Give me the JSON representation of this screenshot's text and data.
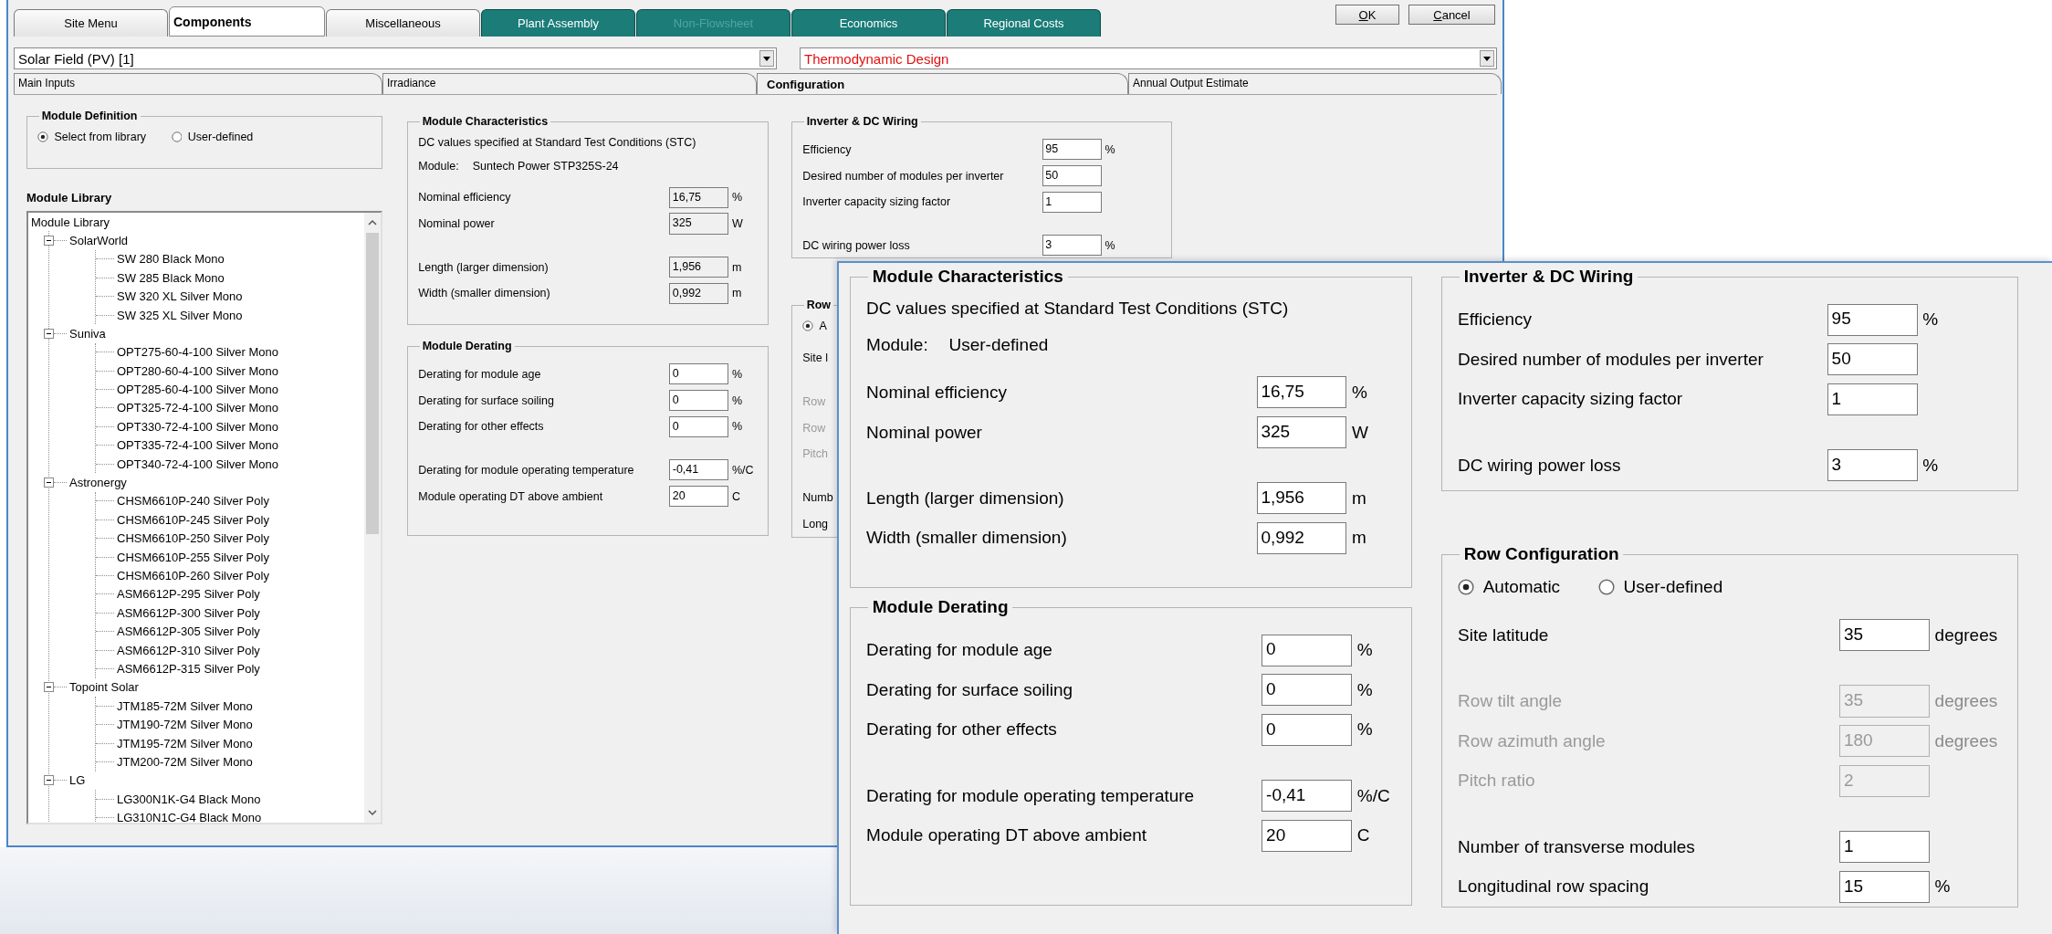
{
  "top_tabs": [
    {
      "label": "Site Menu",
      "selected": false,
      "kind": "menu",
      "disabled": false
    },
    {
      "label": "Components",
      "selected": true,
      "kind": "menu",
      "disabled": false
    },
    {
      "label": "Miscellaneous",
      "selected": false,
      "kind": "menu",
      "disabled": false
    },
    {
      "label": "Plant Assembly",
      "selected": false,
      "kind": "flowsheet",
      "disabled": false
    },
    {
      "label": "Non-Flowsheet",
      "selected": false,
      "kind": "flowsheet",
      "disabled": true
    },
    {
      "label": "Economics",
      "selected": false,
      "kind": "flowsheet",
      "disabled": false
    },
    {
      "label": "Regional Costs",
      "selected": false,
      "kind": "flowsheet",
      "disabled": false
    }
  ],
  "dialog_buttons": [
    {
      "mnemonic": "O",
      "rest": "K"
    },
    {
      "mnemonic": "C",
      "rest": "ancel"
    }
  ],
  "component_select": {
    "value": "Solar Field (PV) [1]"
  },
  "design_mode_select": {
    "value": "Thermodynamic Design"
  },
  "sub_tabs": [
    {
      "label": "Main Inputs",
      "selected": false
    },
    {
      "label": "Irradiance",
      "selected": false
    },
    {
      "label": "Configuration",
      "selected": true
    },
    {
      "label": "Annual Output Estimate",
      "selected": false
    }
  ],
  "configuration": {
    "module_definition": {
      "title": "Module Definition",
      "options": [
        {
          "label": "Select from library",
          "selected": true
        },
        {
          "label": "User-defined",
          "selected": false
        }
      ]
    },
    "module_library": {
      "title": "Module Library",
      "tree": {
        "label": "Module Library",
        "children": [
          {
            "label": "SolarWorld",
            "expanded": true,
            "children": [
              {
                "label": "SW 280 Black Mono"
              },
              {
                "label": "SW 285 Black Mono"
              },
              {
                "label": "SW 320 XL Silver Mono"
              },
              {
                "label": "SW 325 XL Silver Mono"
              }
            ]
          },
          {
            "label": "Suniva",
            "expanded": true,
            "children": [
              {
                "label": "OPT275-60-4-100 Silver Mono"
              },
              {
                "label": "OPT280-60-4-100 Silver Mono"
              },
              {
                "label": "OPT285-60-4-100 Silver Mono"
              },
              {
                "label": "OPT325-72-4-100 Silver Mono"
              },
              {
                "label": "OPT330-72-4-100 Silver Mono"
              },
              {
                "label": "OPT335-72-4-100 Silver Mono"
              },
              {
                "label": "OPT340-72-4-100 Silver Mono"
              }
            ]
          },
          {
            "label": "Astronergy",
            "expanded": true,
            "children": [
              {
                "label": "CHSM6610P-240 Silver Poly"
              },
              {
                "label": "CHSM6610P-245 Silver Poly"
              },
              {
                "label": "CHSM6610P-250 Silver Poly"
              },
              {
                "label": "CHSM6610P-255 Silver Poly"
              },
              {
                "label": "CHSM6610P-260 Silver Poly"
              },
              {
                "label": "ASM6612P-295 Silver Poly"
              },
              {
                "label": "ASM6612P-300 Silver Poly"
              },
              {
                "label": "ASM6612P-305 Silver Poly"
              },
              {
                "label": "ASM6612P-310 Silver Poly"
              },
              {
                "label": "ASM6612P-315 Silver Poly"
              }
            ]
          },
          {
            "label": "Topoint Solar",
            "expanded": true,
            "children": [
              {
                "label": "JTM185-72M Silver Mono"
              },
              {
                "label": "JTM190-72M Silver Mono"
              },
              {
                "label": "JTM195-72M Silver Mono"
              },
              {
                "label": "JTM200-72M Silver Mono"
              }
            ]
          },
          {
            "label": "LG",
            "expanded": true,
            "children": [
              {
                "label": "LG300N1K-G4 Black Mono"
              },
              {
                "label": "LG310N1C-G4 Black Mono"
              }
            ]
          }
        ]
      }
    },
    "module_characteristics": {
      "title": "Module Characteristics",
      "lines": [
        {
          "label": "DC values specified at Standard Test Conditions (STC)"
        },
        {
          "label": "Module:",
          "value": "Suntech Power STP325S-24"
        }
      ],
      "groups": [
        [
          {
            "label": "Nominal efficiency",
            "value": "16,75",
            "unit": "%",
            "readonly": true
          },
          {
            "label": "Nominal power",
            "value": "325",
            "unit": "W",
            "readonly": true
          }
        ],
        [
          {
            "label": "Length (larger dimension)",
            "value": "1,956",
            "unit": "m",
            "readonly": true
          },
          {
            "label": "Width (smaller dimension)",
            "value": "0,992",
            "unit": "m",
            "readonly": true
          }
        ]
      ]
    },
    "module_derating": {
      "title": "Module Derating",
      "groups": [
        [
          {
            "label": "Derating for module age",
            "value": "0",
            "unit": "%"
          },
          {
            "label": "Derating for surface soiling",
            "value": "0",
            "unit": "%"
          },
          {
            "label": "Derating for other effects",
            "value": "0",
            "unit": "%"
          }
        ],
        [
          {
            "label": "Derating for module operating temperature",
            "value": "-0,41",
            "unit": "%/C"
          },
          {
            "label": "Module operating DT above ambient",
            "value": "20",
            "unit": "C"
          }
        ]
      ]
    },
    "inverter": {
      "title": "Inverter & DC Wiring",
      "groups": [
        [
          {
            "label": "Efficiency",
            "value": "95",
            "unit": "%"
          },
          {
            "label": "Desired number of modules per inverter",
            "value": "50"
          },
          {
            "label": "Inverter capacity sizing factor",
            "value": "1"
          }
        ],
        [
          {
            "label": "DC wiring power loss",
            "value": "3",
            "unit": "%"
          }
        ]
      ]
    },
    "row_configuration": {
      "title": "Row",
      "options": [
        {
          "label": "A",
          "selected": true
        }
      ],
      "groups": [
        [
          {
            "label": "Site l"
          }
        ],
        [
          {
            "label": "Row",
            "disabled": true
          },
          {
            "label": "Row",
            "disabled": true
          },
          {
            "label": "Pitch",
            "disabled": true
          }
        ],
        [
          {
            "label": "Numb"
          },
          {
            "label": "Long"
          }
        ]
      ]
    }
  },
  "zoomed_view": {
    "module_characteristics": {
      "title": "Module Characteristics",
      "lines": [
        {
          "label": "DC values specified at Standard Test Conditions (STC)"
        },
        {
          "label": "Module:",
          "value": "User-defined"
        }
      ],
      "groups": [
        [
          {
            "label": "Nominal efficiency",
            "value": "16,75",
            "unit": "%",
            "readonly": false
          },
          {
            "label": "Nominal power",
            "value": "325",
            "unit": "W",
            "readonly": false
          }
        ],
        [
          {
            "label": "Length (larger dimension)",
            "value": "1,956",
            "unit": "m",
            "readonly": false
          },
          {
            "label": "Width (smaller dimension)",
            "value": "0,992",
            "unit": "m",
            "readonly": false
          }
        ]
      ]
    },
    "module_derating": {
      "title": "Module Derating",
      "groups": [
        [
          {
            "label": "Derating for module age",
            "value": "0",
            "unit": "%"
          },
          {
            "label": "Derating for surface soiling",
            "value": "0",
            "unit": "%"
          },
          {
            "label": "Derating for other effects",
            "value": "0",
            "unit": "%"
          }
        ],
        [
          {
            "label": "Derating for module operating temperature",
            "value": "-0,41",
            "unit": "%/C"
          },
          {
            "label": "Module operating DT above ambient",
            "value": "20",
            "unit": "C"
          }
        ]
      ]
    },
    "inverter": {
      "title": "Inverter & DC Wiring",
      "groups": [
        [
          {
            "label": "Efficiency",
            "value": "95",
            "unit": "%"
          },
          {
            "label": "Desired number of modules per inverter",
            "value": "50"
          },
          {
            "label": "Inverter capacity sizing factor",
            "value": "1"
          }
        ],
        [
          {
            "label": "DC wiring power loss",
            "value": "3",
            "unit": "%"
          }
        ]
      ]
    },
    "row_configuration": {
      "title": "Row Configuration",
      "options": [
        {
          "label": "Automatic",
          "selected": true
        },
        {
          "label": "User-defined",
          "selected": false
        }
      ],
      "groups": [
        [
          {
            "label": "Site latitude",
            "value": "35",
            "unit": "degrees",
            "disabled": false
          }
        ],
        [
          {
            "label": "Row tilt angle",
            "value": "35",
            "unit": "degrees",
            "disabled": true
          },
          {
            "label": "Row azimuth angle",
            "value": "180",
            "unit": "degrees",
            "disabled": true
          },
          {
            "label": "Pitch ratio",
            "value": "2",
            "disabled": true
          }
        ],
        [
          {
            "label": "Number of transverse modules",
            "value": "1",
            "disabled": false
          },
          {
            "label": "Longitudinal row spacing",
            "value": "15",
            "unit": "%",
            "disabled": false
          }
        ]
      ]
    }
  }
}
